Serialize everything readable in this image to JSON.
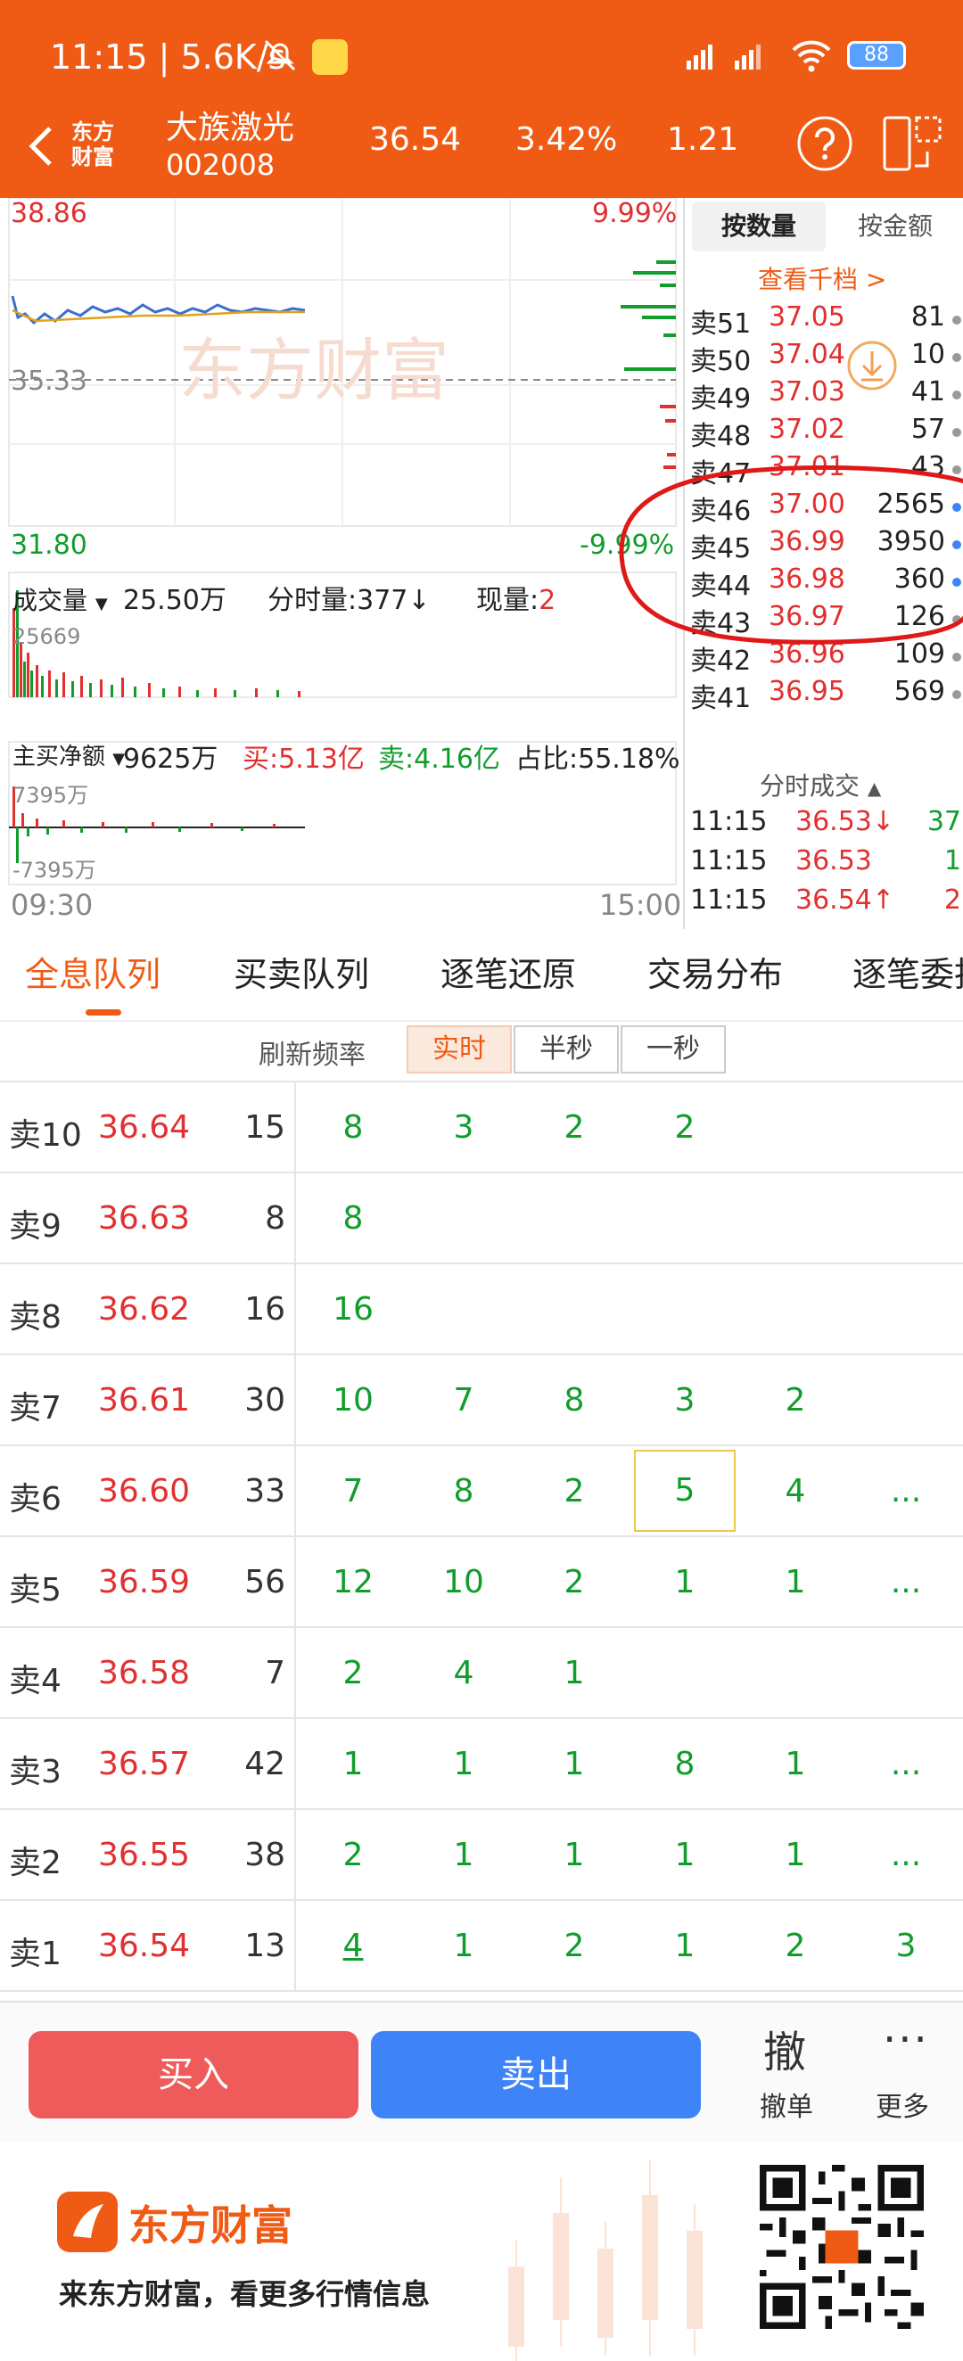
{
  "status_bar": {
    "time": "11:15",
    "speed": "5.6K/s",
    "battery": "88",
    "icons": [
      "mute-icon",
      "weibo-icon",
      "signal-hd-icon",
      "wifi-icon",
      "battery-icon"
    ]
  },
  "header": {
    "logo_line1": "东方",
    "logo_line2": "财富",
    "stock_name": "大族激光",
    "stock_code": "002008",
    "price": "36.54",
    "change_pct": "3.42%",
    "change": "1.21"
  },
  "chart": {
    "price_high": "38.86",
    "pct_high": "9.99%",
    "price_mid": "35.33",
    "price_low": "31.80",
    "pct_low": "-9.99%",
    "volume_label": "成交量",
    "volume_value": "25.50万",
    "tick_volume": "分时量:377↓",
    "current_volume_label": "现量:",
    "current_volume_value": "2",
    "volume_axis_top": "25669",
    "flow_label": "主买净额",
    "flow_value": "9625万",
    "buy_label": "买:5.13亿",
    "sell_label": "卖:4.16亿",
    "ratio_label": "占比:55.18%",
    "flow_axis_top": "7395万",
    "flow_axis_bottom": "-7395万",
    "time_start": "09:30",
    "time_end": "15:00",
    "watermark": "东方财富",
    "colors": {
      "price_line": "#3a6fd0",
      "avg_line": "#e0a21a",
      "up": "#e23030",
      "down": "#119d2c"
    }
  },
  "depth_panel": {
    "seg_qty": "按数量",
    "seg_amount": "按金额",
    "more_levels": "查看千档 >",
    "rows": [
      {
        "level": "卖51",
        "price": "37.05",
        "volume": "81",
        "dot": "#999999"
      },
      {
        "level": "卖50",
        "price": "37.04",
        "volume": "10",
        "dot": "#999999"
      },
      {
        "level": "卖49",
        "price": "37.03",
        "volume": "41",
        "dot": "#999999"
      },
      {
        "level": "卖48",
        "price": "37.02",
        "volume": "57",
        "dot": "#999999"
      },
      {
        "level": "卖47",
        "price": "37.01",
        "volume": "43",
        "dot": "#999999"
      },
      {
        "level": "卖46",
        "price": "37.00",
        "volume": "2565",
        "dot": "#3f83f8"
      },
      {
        "level": "卖45",
        "price": "36.99",
        "volume": "3950",
        "dot": "#3f83f8"
      },
      {
        "level": "卖44",
        "price": "36.98",
        "volume": "360",
        "dot": "#3f83f8"
      },
      {
        "level": "卖43",
        "price": "36.97",
        "volume": "126",
        "dot": "#999999"
      },
      {
        "level": "卖42",
        "price": "36.96",
        "volume": "109",
        "dot": "#999999"
      },
      {
        "level": "卖41",
        "price": "36.95",
        "volume": "569",
        "dot": "#999999"
      }
    ],
    "ticks_title": "分时成交",
    "ticks": [
      {
        "time": "11:15",
        "price": "36.53↓",
        "volume": "37",
        "vcolor": "#119d2c"
      },
      {
        "time": "11:15",
        "price": "36.53",
        "volume": "1",
        "vcolor": "#119d2c"
      },
      {
        "time": "11:15",
        "price": "36.54↑",
        "volume": "2",
        "vcolor": "#e23030"
      }
    ]
  },
  "tabs": [
    "全息队列",
    "买卖队列",
    "逐笔还原",
    "交易分布",
    "逐笔委托"
  ],
  "refresh": {
    "label": "刷新频率",
    "options": [
      "实时",
      "半秒",
      "一秒"
    ]
  },
  "queue": [
    {
      "level": "卖10",
      "price": "36.64",
      "volume": "15",
      "orders": [
        "8",
        "3",
        "2",
        "2"
      ]
    },
    {
      "level": "卖9",
      "price": "36.63",
      "volume": "8",
      "orders": [
        "8"
      ]
    },
    {
      "level": "卖8",
      "price": "36.62",
      "volume": "16",
      "orders": [
        "16"
      ]
    },
    {
      "level": "卖7",
      "price": "36.61",
      "volume": "30",
      "orders": [
        "10",
        "7",
        "8",
        "3",
        "2"
      ]
    },
    {
      "level": "卖6",
      "price": "36.60",
      "volume": "33",
      "orders": [
        "7",
        "8",
        "2",
        "5",
        "4",
        "..."
      ]
    },
    {
      "level": "卖5",
      "price": "36.59",
      "volume": "56",
      "orders": [
        "12",
        "10",
        "2",
        "1",
        "1",
        "..."
      ]
    },
    {
      "level": "卖4",
      "price": "36.58",
      "volume": "7",
      "orders": [
        "2",
        "4",
        "1"
      ]
    },
    {
      "level": "卖3",
      "price": "36.57",
      "volume": "42",
      "orders": [
        "1",
        "1",
        "1",
        "8",
        "1",
        "..."
      ]
    },
    {
      "level": "卖2",
      "price": "36.55",
      "volume": "38",
      "orders": [
        "2",
        "1",
        "1",
        "1",
        "1",
        "..."
      ]
    },
    {
      "level": "卖1",
      "price": "36.54",
      "volume": "13",
      "orders": [
        "4",
        "1",
        "2",
        "1",
        "2",
        "3"
      ]
    }
  ],
  "bottom_bar": {
    "buy": "买入",
    "sell": "卖出",
    "cancel_icon": "撤",
    "cancel": "撤单",
    "more_icon": "···",
    "more": "更多"
  },
  "footer": {
    "brand": "东方财富",
    "slogan": "来东方财富，看更多行情信息"
  }
}
